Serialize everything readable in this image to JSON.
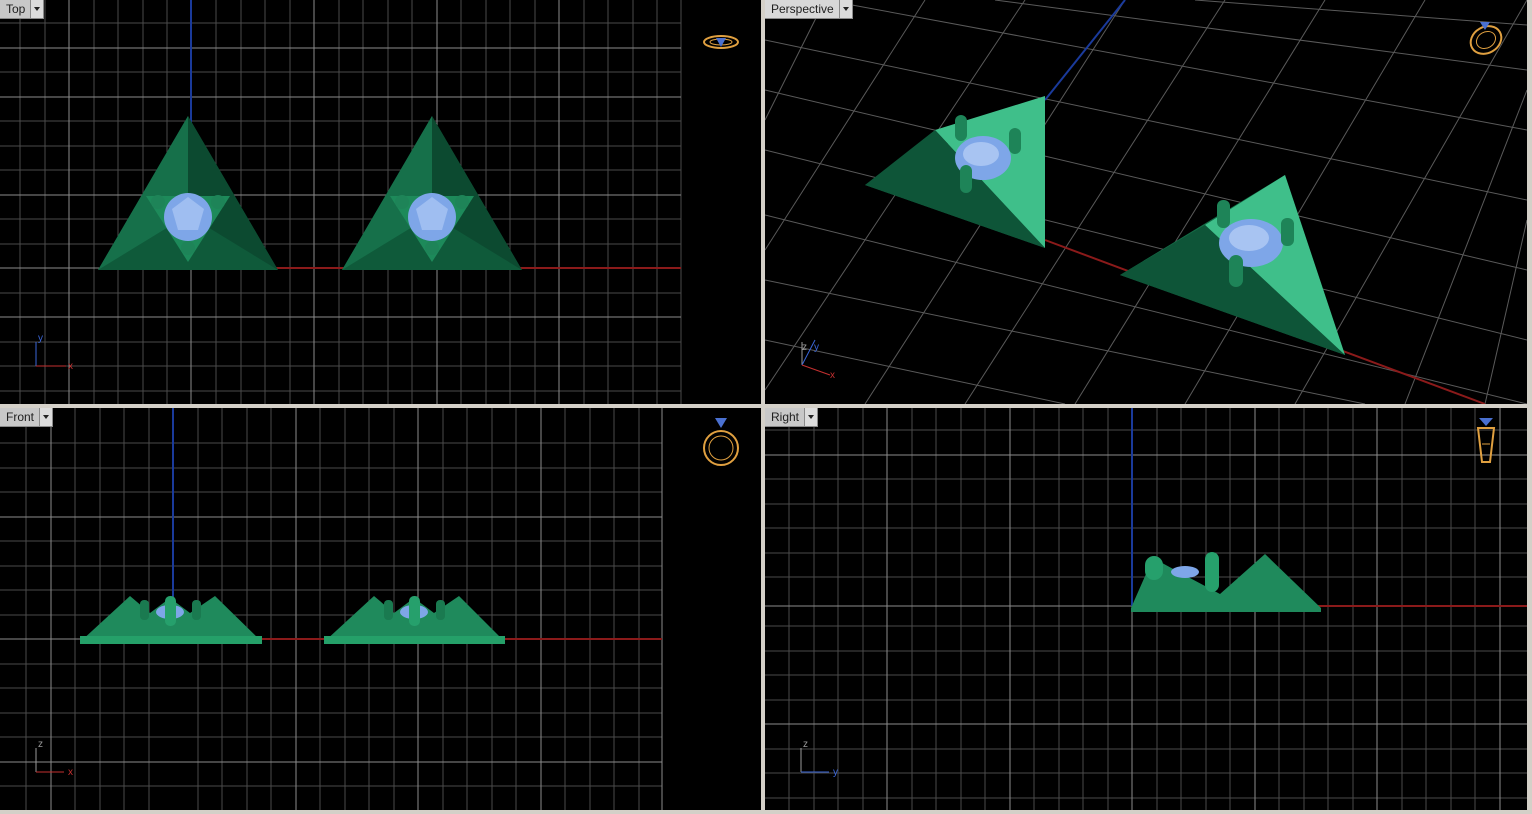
{
  "viewports": {
    "top": {
      "title": "Top",
      "axis_labels": {
        "first": "y",
        "second": "x"
      },
      "gizmo_icon": "ring-top-view-icon"
    },
    "perspective": {
      "title": "Perspective",
      "axis_labels": {
        "z": "z",
        "y": "y",
        "x": "x"
      },
      "gizmo_icon": "ring-perspective-view-icon"
    },
    "front": {
      "title": "Front",
      "axis_labels": {
        "first": "z",
        "second": "x"
      },
      "gizmo_icon": "ring-front-view-icon"
    },
    "right": {
      "title": "Right",
      "axis_labels": {
        "first": "z",
        "second": "y"
      },
      "gizmo_icon": "ring-right-view-icon"
    }
  },
  "colors": {
    "background": "#000000",
    "grid": "#5a5a5a",
    "x_axis": "#8b1a1a",
    "y_axis": "#1a3a9b",
    "model_green": "#1f7a52",
    "gem_blue": "#7ea6e8",
    "gizmo_orange": "#e0a040"
  }
}
